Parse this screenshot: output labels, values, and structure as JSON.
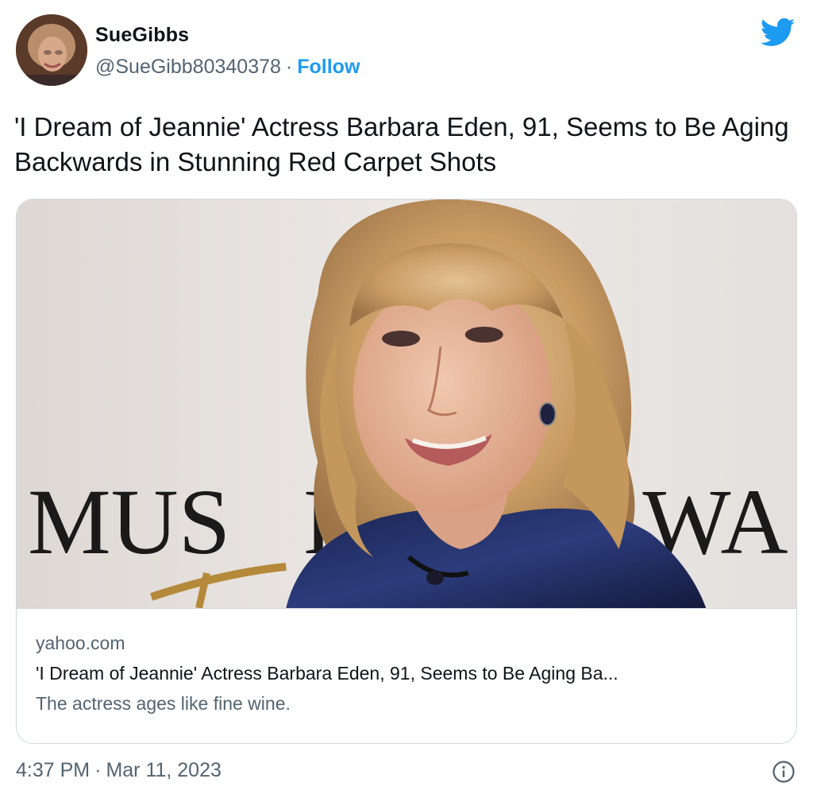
{
  "author": {
    "display_name": "SueGibbs",
    "handle": "@SueGibb80340378",
    "separator": "·",
    "follow_label": "Follow",
    "avatar_icon": "user-avatar"
  },
  "brand": {
    "icon": "twitter-bird-icon",
    "color": "#1d9bf0"
  },
  "tweet": {
    "text": "'I Dream of Jeannie' Actress Barbara Eden, 91, Seems to Be Aging Backwards in Stunning Red Carpet Shots"
  },
  "card": {
    "image_backdrop_text_left": "MUS",
    "image_backdrop_text_mid": "E",
    "image_backdrop_text_right": "WA",
    "domain": "yahoo.com",
    "title": "'I Dream of Jeannie' Actress Barbara Eden, 91, Seems to Be Aging Ba...",
    "description": "The actress ages like fine wine."
  },
  "footer": {
    "time": "4:37 PM",
    "separator": "·",
    "date": "Mar 11, 2023",
    "info_icon": "info-icon"
  }
}
